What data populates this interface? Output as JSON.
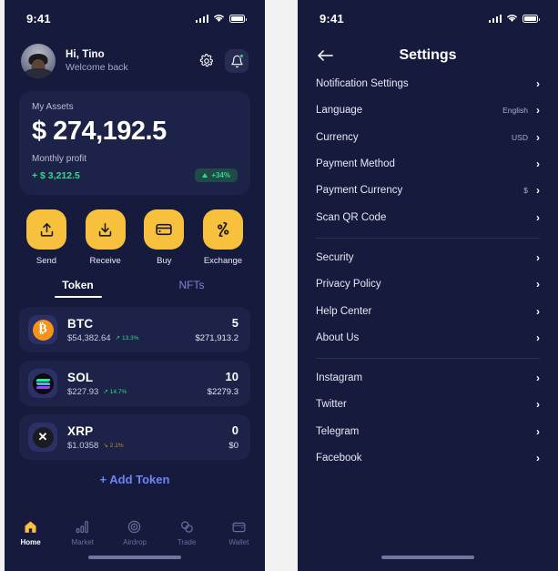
{
  "status_bar": {
    "time": "9:41",
    "icons": [
      "signal-icon",
      "wifi-icon",
      "battery-icon"
    ]
  },
  "wallet": {
    "header": {
      "greeting": "Hi, Tino",
      "subtitle": "Welcome back",
      "settings_icon": "gear-icon",
      "notifications_icon": "bell-icon"
    },
    "assets_card": {
      "label": "My Assets",
      "amount": "$ 274,192.5",
      "profit_label": "Monthly profit",
      "profit_value": "+ $ 3,212.5",
      "change_badge": "+34%",
      "positive_color": "#2fd98a",
      "card_color": "#1d2348"
    },
    "actions": [
      {
        "label": "Send",
        "icon": "upload-icon"
      },
      {
        "label": "Receive",
        "icon": "download-icon"
      },
      {
        "label": "Buy",
        "icon": "credit-card-icon"
      },
      {
        "label": "Exchange",
        "icon": "exchange-arrows-icon"
      }
    ],
    "accent_color": "#f7c13e",
    "tabs": [
      {
        "label": "Token",
        "active": true
      },
      {
        "label": "NFTs",
        "active": false
      }
    ],
    "tokens": [
      {
        "symbol": "BTC",
        "logo": "bitcoin-icon",
        "price": "$54,382.64",
        "change": "13.3%",
        "direction": "up",
        "quantity": "5",
        "value": "$271,913.2"
      },
      {
        "symbol": "SOL",
        "logo": "solana-icon",
        "price": "$227.93",
        "change": "14.7%",
        "direction": "up",
        "quantity": "10",
        "value": "$2279.3"
      },
      {
        "symbol": "XRP",
        "logo": "ripple-icon",
        "price": "$1.0358",
        "change": "2.1%",
        "direction": "down",
        "quantity": "0",
        "value": "$0"
      }
    ],
    "add_token": "+ Add Token",
    "bottom_nav": [
      {
        "label": "Home",
        "icon": "home-icon",
        "active": true
      },
      {
        "label": "Market",
        "icon": "bar-chart-icon",
        "active": false
      },
      {
        "label": "Airdrop",
        "icon": "target-icon",
        "active": false
      },
      {
        "label": "Trade",
        "icon": "trade-circles-icon",
        "active": false
      },
      {
        "label": "Wallet",
        "icon": "wallet-icon",
        "active": false
      }
    ]
  },
  "settings": {
    "title": "Settings",
    "back_icon": "arrow-left-icon",
    "groups": [
      {
        "items": [
          {
            "label": "Notification Settings",
            "value": ""
          },
          {
            "label": "Language",
            "value": "English"
          },
          {
            "label": "Currency",
            "value": "USD"
          },
          {
            "label": "Payment Method",
            "value": ""
          },
          {
            "label": "Payment Currency",
            "value": "$"
          },
          {
            "label": "Scan QR Code",
            "value": ""
          }
        ]
      },
      {
        "items": [
          {
            "label": "Security",
            "value": ""
          },
          {
            "label": "Privacy Policy",
            "value": ""
          },
          {
            "label": "Help Center",
            "value": ""
          },
          {
            "label": "About Us",
            "value": ""
          }
        ]
      },
      {
        "items": [
          {
            "label": "Instagram",
            "value": ""
          },
          {
            "label": "Twitter",
            "value": ""
          },
          {
            "label": "Telegram",
            "value": ""
          },
          {
            "label": "Facebook",
            "value": ""
          }
        ]
      }
    ],
    "chevron_icon": "chevron-right-icon"
  }
}
